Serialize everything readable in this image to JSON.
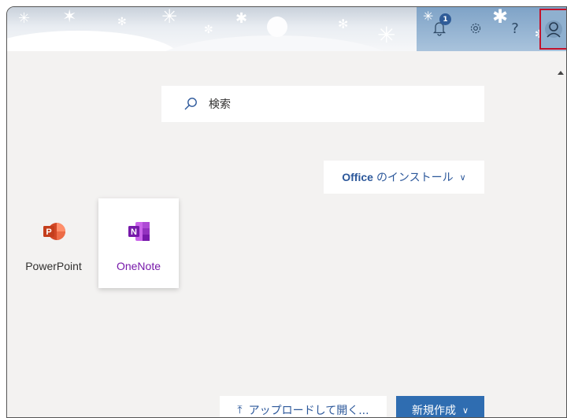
{
  "header": {
    "notification_count": "1",
    "help_symbol": "?",
    "icons": [
      "bell-icon",
      "gear-icon",
      "help-icon",
      "avatar-icon"
    ]
  },
  "search": {
    "label": "検索",
    "icon": "search-icon"
  },
  "install": {
    "office_label": "Office",
    "rest_label": "のインストール",
    "chevron": "∨"
  },
  "apps": [
    {
      "label": "PowerPoint",
      "icon_letter": "P",
      "icon": "powerpoint-icon",
      "color": "#c43e1c"
    },
    {
      "label": "OneNote",
      "icon_letter": "N",
      "icon": "onenote-icon",
      "color": "#7719aa"
    }
  ],
  "footer": {
    "upload_arrow": "⤒",
    "upload_label": "アップロードして開く...",
    "new_label": "新規作成",
    "new_chevron": "∨"
  },
  "colors": {
    "accent": "#2b579a",
    "primary_button": "#2f6db1",
    "avatar_highlight": "#c3122b",
    "background": "#f3f2f1"
  }
}
